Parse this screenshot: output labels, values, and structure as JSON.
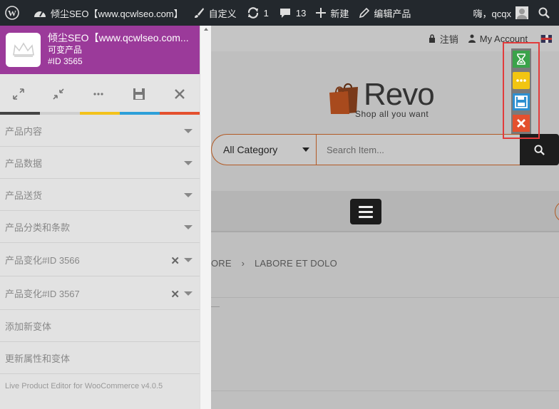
{
  "admin_bar": {
    "site_name": "倾尘SEO【www.qcwlseo.com】",
    "customize": "自定义",
    "updates_count": "1",
    "comments_count": "13",
    "new_label": "新建",
    "edit_product": "编辑产品",
    "greeting": "嗨，qcqx"
  },
  "header": {
    "logout": "注销",
    "my_account": "My Account",
    "logo_brand": "Revo",
    "logo_tagline": "Shop all you want"
  },
  "search": {
    "category": "All Category",
    "placeholder": "Search Item..."
  },
  "breadcrumb": {
    "item1": "ORE",
    "sep": "›",
    "item2": "LABORE ET DOLO"
  },
  "panel": {
    "title": "倾尘SEO【www.qcwlseo.com...",
    "product_type": "可变产品",
    "product_id": "#ID 3565",
    "sections": [
      {
        "label": "产品内容"
      },
      {
        "label": "产品数据"
      },
      {
        "label": "产品送货"
      },
      {
        "label": "产品分类和条款"
      },
      {
        "label": "产品变化#ID 3566"
      },
      {
        "label": "产品变化#ID 3567"
      },
      {
        "label": "添加新变体"
      },
      {
        "label": "更新属性和变体"
      }
    ],
    "footer": "Live Product Editor for WooCommerce v4.0.5",
    "color_strip": [
      "#444444",
      "#cfcfcf",
      "#f3c21b",
      "#2d9fd8",
      "#e4502e"
    ]
  },
  "floating_toolbar": {
    "hourglass_color": "#3aa34a",
    "more_color": "#f2c511",
    "save_color": "#2d8fd0",
    "close_color": "#e4502e"
  }
}
